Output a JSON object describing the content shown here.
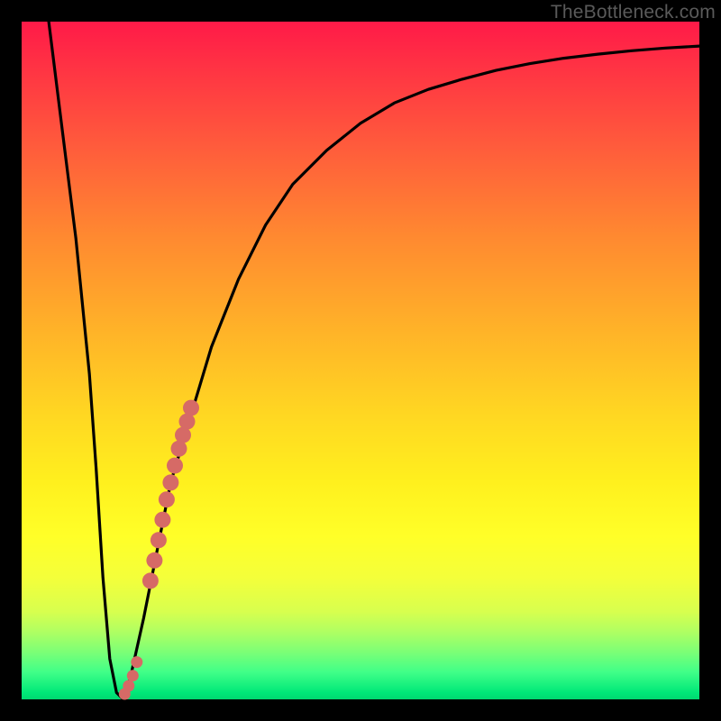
{
  "watermark": "TheBottleneck.com",
  "colors": {
    "frame": "#000000",
    "curve": "#000000",
    "marker": "#d66a66",
    "gradient_top": "#ff1a48",
    "gradient_bottom": "#00d870"
  },
  "chart_data": {
    "type": "line",
    "title": "",
    "xlabel": "",
    "ylabel": "",
    "xlim": [
      0,
      100
    ],
    "ylim": [
      0,
      100
    ],
    "grid": false,
    "legend": false,
    "series": [
      {
        "name": "bottleneck-curve",
        "x": [
          4,
          6,
          8,
          10,
          11,
          12,
          13,
          14,
          15,
          16,
          18,
          20,
          22,
          25,
          28,
          32,
          36,
          40,
          45,
          50,
          55,
          60,
          65,
          70,
          75,
          80,
          85,
          90,
          95,
          100
        ],
        "y": [
          100,
          84,
          68,
          48,
          34,
          18,
          6,
          1,
          0,
          3,
          12,
          22,
          32,
          42,
          52,
          62,
          70,
          76,
          81,
          85,
          88,
          90,
          91.5,
          92.8,
          93.8,
          94.6,
          95.2,
          95.7,
          96.1,
          96.4
        ]
      }
    ],
    "markers": [
      {
        "name": "highlight-segment-upper",
        "x": [
          19.0,
          19.6,
          20.2,
          20.8,
          21.4,
          22.0,
          22.6,
          23.2,
          23.8,
          24.4,
          25.0
        ],
        "y": [
          17.5,
          20.5,
          23.5,
          26.5,
          29.5,
          32.0,
          34.5,
          37.0,
          39.0,
          41.0,
          43.0
        ]
      },
      {
        "name": "highlight-segment-lower",
        "x": [
          15.2,
          15.8,
          16.4,
          17.0
        ],
        "y": [
          0.8,
          2.0,
          3.5,
          5.5
        ]
      }
    ]
  }
}
